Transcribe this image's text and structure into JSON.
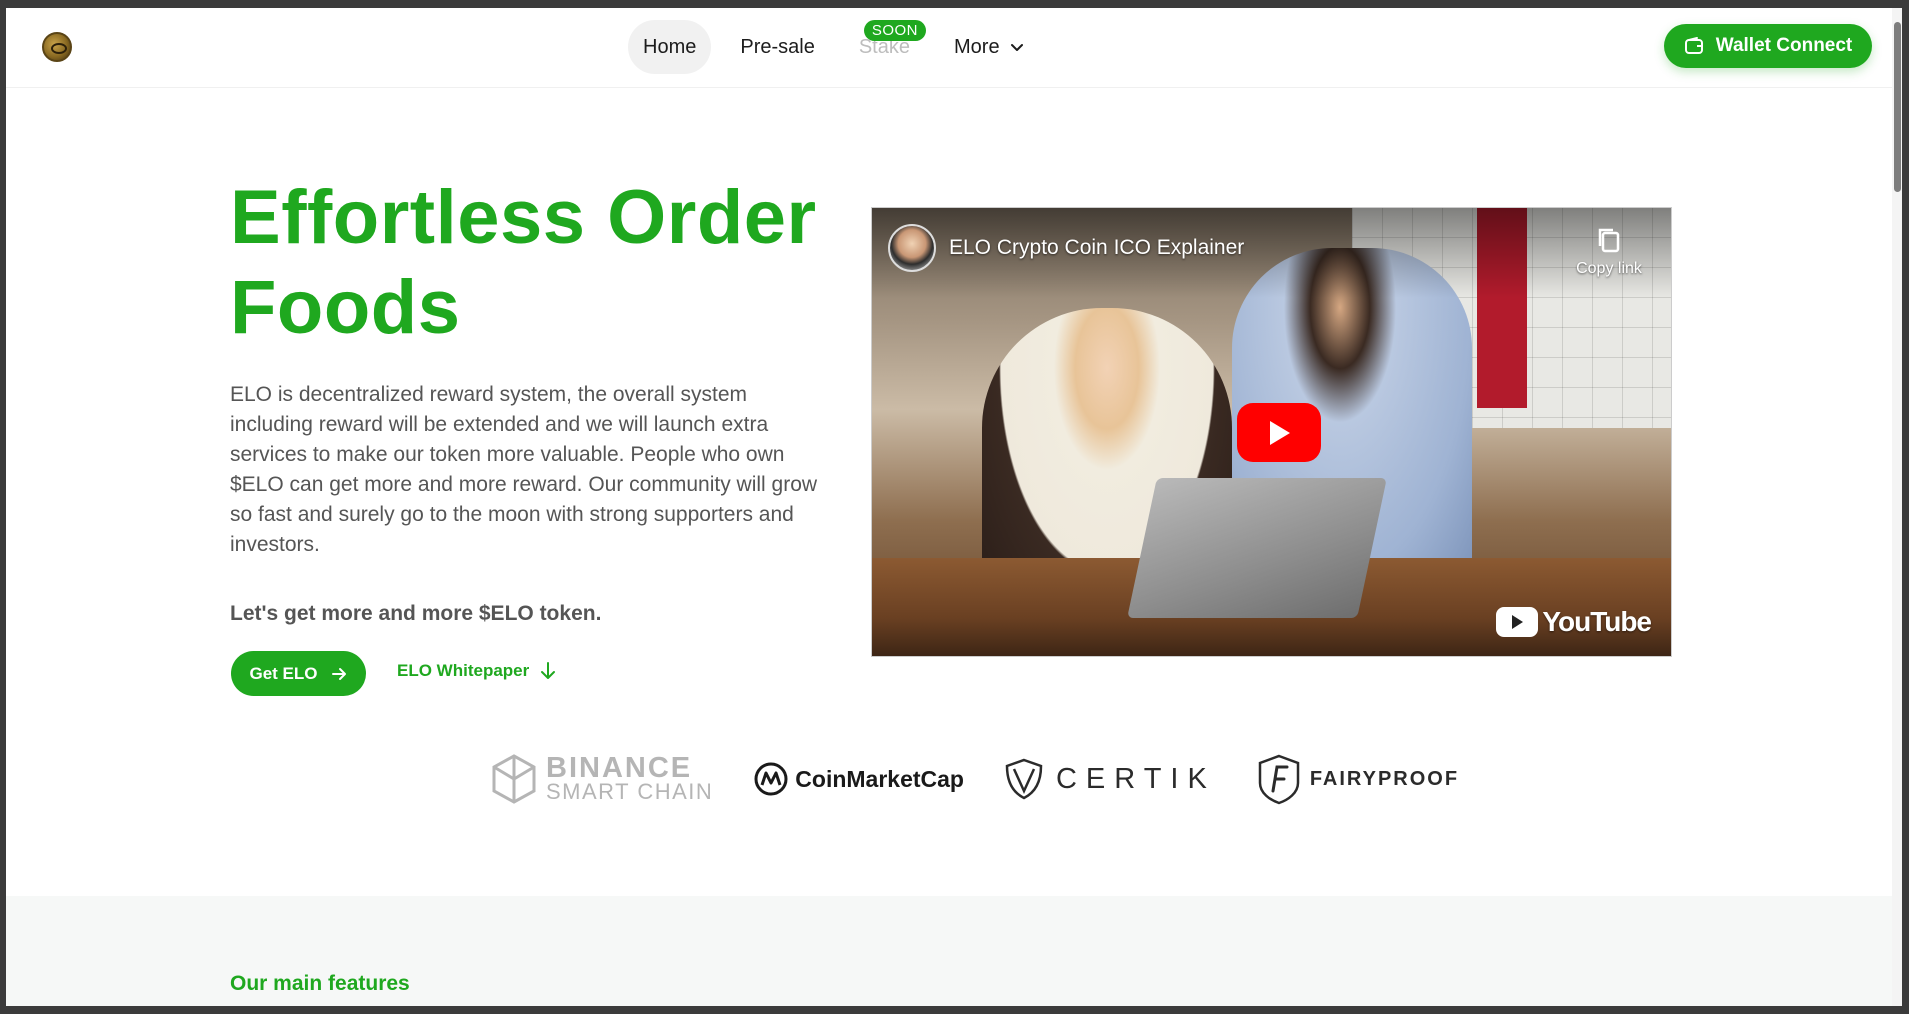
{
  "header": {
    "nav": [
      {
        "label": "Home",
        "state": "active"
      },
      {
        "label": "Pre-sale",
        "state": "default"
      },
      {
        "label": "Stake",
        "state": "disabled",
        "badge": "SOON"
      },
      {
        "label": "More",
        "state": "default"
      }
    ],
    "wallet_button": "Wallet Connect"
  },
  "hero": {
    "title": "Effortless Order Foods",
    "description": "ELO is decentralized reward system, the overall system including reward will be extended and we will launch extra services to make our token more valuable. People who own $ELO can get more and more reward. Our community will grow so fast and surely go to the moon with strong supporters and investors.",
    "subtitle": "Let's get more and more $ELO token.",
    "get_button": "Get ELO",
    "whitepaper_link": "ELO Whitepaper"
  },
  "video": {
    "title": "ELO Crypto Coin ICO Explainer",
    "copy_link": "Copy link",
    "brand": "YouTube"
  },
  "partners": {
    "binance_line1": "BINANCE",
    "binance_line2": "SMART CHAIN",
    "coinmarketcap": "CoinMarketCap",
    "certik": "CERTIK",
    "fairyproof": "FAIRYPROOF"
  },
  "features": {
    "title": "Our main features"
  },
  "colors": {
    "brand_green": "#1fa81f",
    "text_gray": "#555555"
  }
}
